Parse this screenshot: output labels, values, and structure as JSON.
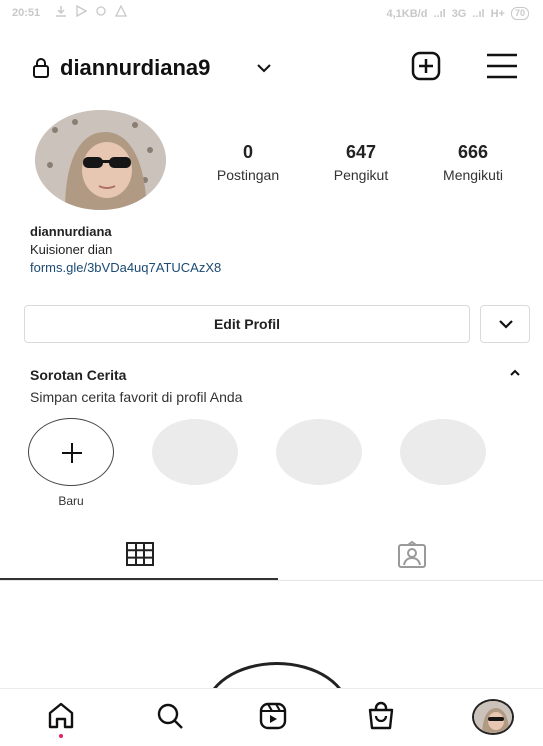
{
  "status_bar": {
    "time": "20:51",
    "network_speed": "4,1KB/d",
    "network_types": "3G",
    "network_type2": "H+",
    "battery": "70"
  },
  "header": {
    "username": "diannurdiana9"
  },
  "stats": [
    {
      "value": "0",
      "label": "Postingan"
    },
    {
      "value": "647",
      "label": "Pengikut"
    },
    {
      "value": "666",
      "label": "Mengikuti"
    }
  ],
  "bio": {
    "name": "diannurdiana",
    "text": "Kuisioner dian",
    "link": "forms.gle/3bVDa4uq7ATUCAzX8"
  },
  "edit_profile_label": "Edit Profil",
  "highlights": {
    "title": "Sorotan Cerita",
    "subtitle": "Simpan cerita favorit di profil Anda",
    "new_label": "Baru"
  },
  "icons": {
    "lock": "lock-icon",
    "chevron": "chevron-down-icon",
    "new_post": "plus-square-icon",
    "menu": "hamburger-menu-icon",
    "grid": "grid-icon",
    "tagged": "tagged-person-icon",
    "home": "home-icon",
    "search": "search-icon",
    "reels": "reels-icon",
    "shop": "shop-icon"
  },
  "colors": {
    "link": "#1c4a73",
    "text": "#222222",
    "border": "#dadada",
    "placeholder": "#ebebeb",
    "notification_dot": "#e0245e"
  }
}
